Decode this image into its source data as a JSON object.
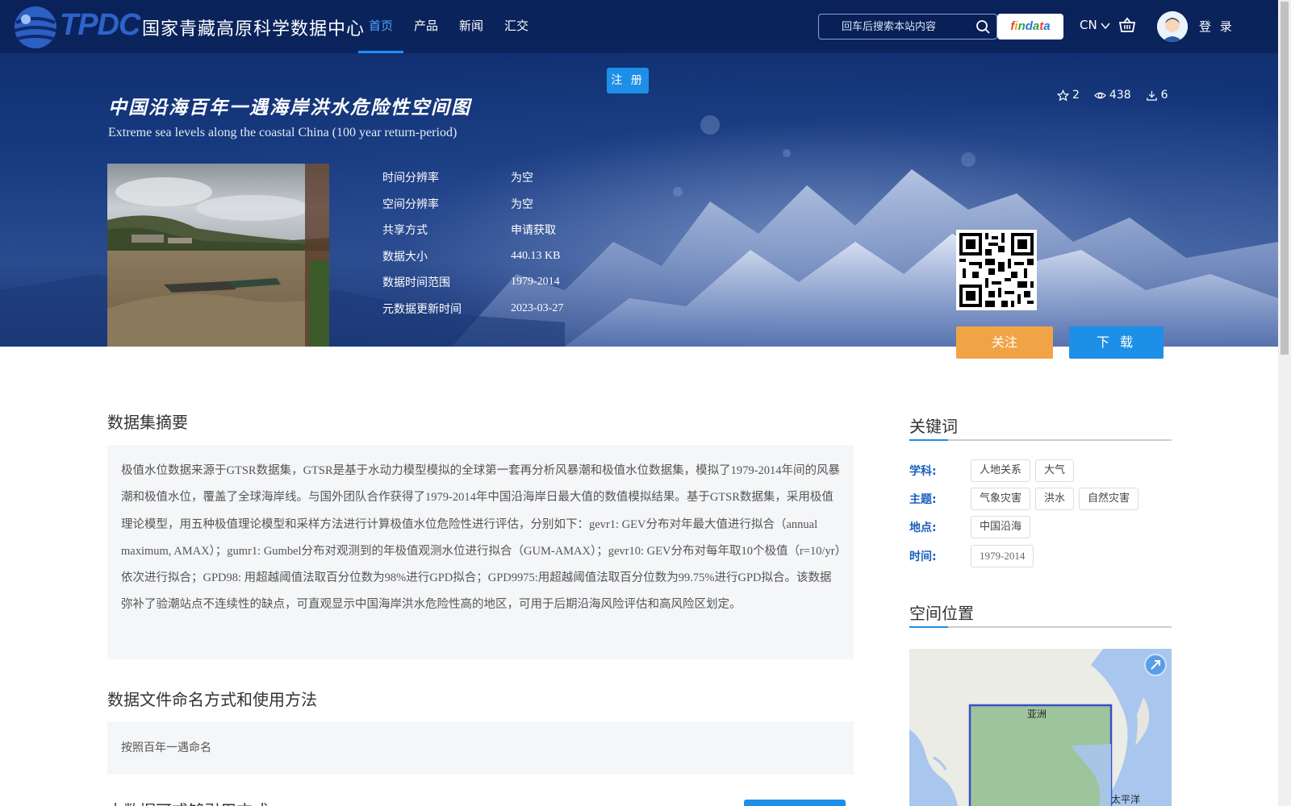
{
  "header": {
    "logo_en": "TPDC",
    "logo_cn": "国家青藏高原科学数据中心",
    "nav": [
      {
        "label": "首页",
        "active": true
      },
      {
        "label": "产品",
        "active": false
      },
      {
        "label": "新闻",
        "active": false
      },
      {
        "label": "汇交",
        "active": false
      }
    ],
    "search_placeholder": "回车后搜索本站内容",
    "findata_label": "findata",
    "lang_label": "CN",
    "login_label": "登 录"
  },
  "register_label": "注 册",
  "dataset": {
    "title_cn": "中国沿海百年一遇海岸洪水危险性空间图",
    "title_en": "Extreme sea levels along the coastal China (100 year return-period)",
    "stats": {
      "stars": "2",
      "views": "438",
      "downloads": "6"
    },
    "meta": [
      {
        "label": "时间分辨率",
        "value": "为空"
      },
      {
        "label": "空间分辨率",
        "value": "为空"
      },
      {
        "label": "共享方式",
        "value": "申请获取"
      },
      {
        "label": "数据大小",
        "value": "440.13 KB"
      },
      {
        "label": "数据时间范围",
        "value": "1979-2014"
      },
      {
        "label": "元数据更新时间",
        "value": "2023-03-27"
      }
    ],
    "follow_label": "关注",
    "download_label": "下 载"
  },
  "main": {
    "abstract_title": "数据集摘要",
    "abstract_text": "极值水位数据来源于GTSR数据集，GTSR是基于水动力模型模拟的全球第一套再分析风暴潮和极值水位数据集，模拟了1979-2014年间的风暴潮和极值水位，覆盖了全球海岸线。与国外团队合作获得了1979-2014年中国沿海岸日最大值的数值模拟结果。基于GTSR数据集，采用极值理论模型，用五种极值理论模型和采样方法进行计算极值水位危险性进行评估，分别如下：gevr1: GEV分布对年最大值进行拟合（annual maximum, AMAX）；gumr1: Gumbel分布对观测到的年极值观测水位进行拟合（GUM-AMAX）；gevr10: GEV分布对每年取10个极值（r=10/yr）依次进行拟合；GPD98: 用超越阈值法取百分位数为98%进行GPD拟合；GPD9975:用超越阈值法取百分位数为99.75%进行GPD拟合。该数据弥补了验潮站点不连续性的缺点，可直观显示中国海岸洪水危险性高的地区，可用于后期沿海风险评估和高风险区划定。",
    "naming_title": "数据文件命名方式和使用方法",
    "naming_text": "按照百年一遇命名",
    "next_title": "本数据可或够引用方式"
  },
  "sidebar": {
    "keywords_title": "关键词",
    "keyword_groups": [
      {
        "label": "学科:",
        "tags": [
          "人地关系",
          "大气"
        ]
      },
      {
        "label": "主题:",
        "tags": [
          "气象灾害",
          "洪水",
          "自然灾害"
        ]
      },
      {
        "label": "地点:",
        "tags": [
          "中国沿海"
        ]
      },
      {
        "label": "时间:",
        "tags": [
          "1979-2014"
        ]
      }
    ],
    "location_title": "空间位置",
    "map_labels": {
      "asia": "亚洲",
      "pacific": "太平洋"
    }
  },
  "colors": {
    "accent": "#1e8fe6",
    "follow": "#f0a446",
    "keyword_label": "#1b5fbd"
  }
}
